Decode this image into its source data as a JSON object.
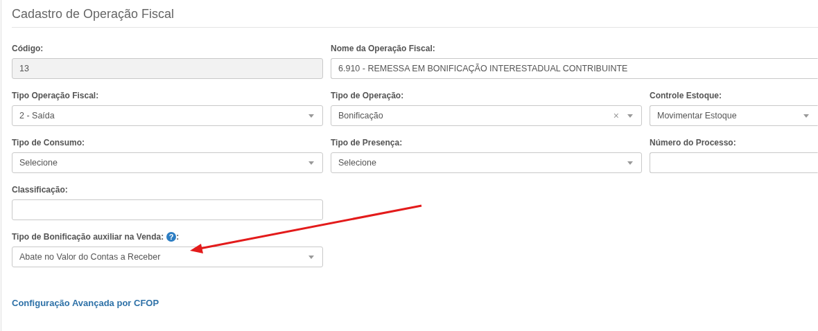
{
  "title": "Cadastro de Operação Fiscal",
  "rows": [
    [
      {
        "label": "Código:",
        "kind": "text",
        "value": "13",
        "disabled": true
      },
      {
        "label": "Nome da Operação Fiscal:",
        "kind": "text",
        "value": "6.910 - REMESSA EM BONIFICAÇÃO INTERESTADUAL CONTRIBUINTE",
        "wide": true
      }
    ],
    [
      {
        "label": "Tipo Operação Fiscal:",
        "kind": "select",
        "value": "2 - Saída"
      },
      {
        "label": "Tipo de Operação:",
        "kind": "select",
        "value": "Bonificação",
        "clear_icon": "×"
      },
      {
        "label": "Controle Estoque:",
        "kind": "select",
        "value": "Movimentar Estoque"
      }
    ],
    [
      {
        "label": "Tipo de Consumo:",
        "kind": "select",
        "value": "Selecione"
      },
      {
        "label": "Tipo de Presença:",
        "kind": "select",
        "value": "Selecione"
      },
      {
        "label": "Número do Processo:",
        "kind": "text"
      }
    ],
    [
      {
        "label": "Classificação:",
        "kind": "text"
      }
    ],
    [
      {
        "label": "Tipo de Bonificação auxiliar na Venda:",
        "kind": "select",
        "value": "Abate no Valor do Contas a Receber",
        "help_icon": "?",
        "label_end": ":"
      }
    ]
  ],
  "link": "Configuração Avançada por CFOP",
  "annotation": {
    "kind": "arrow",
    "color": "#e31b1b"
  }
}
